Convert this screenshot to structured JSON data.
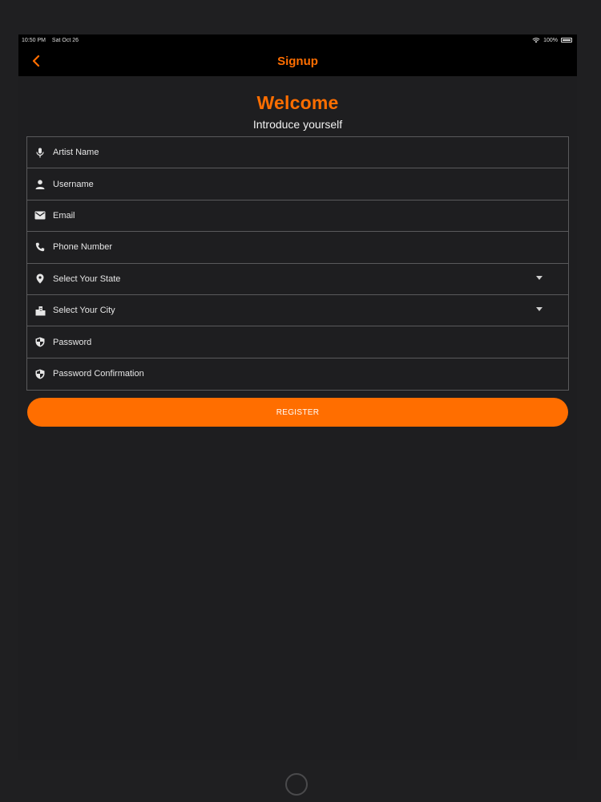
{
  "status_bar": {
    "time": "10:50 PM",
    "date": "Sat Oct 26",
    "battery": "100%"
  },
  "nav": {
    "title": "Signup",
    "back_icon": "chevron-left-icon"
  },
  "header": {
    "welcome": "Welcome",
    "subtitle": "Introduce yourself"
  },
  "form": {
    "fields": [
      {
        "label": "Artist Name",
        "icon": "microphone-icon"
      },
      {
        "label": "Username",
        "icon": "person-icon"
      },
      {
        "label": "Email",
        "icon": "mail-icon"
      },
      {
        "label": "Phone Number",
        "icon": "phone-icon"
      },
      {
        "label": "Select Your State",
        "icon": "location-pin-icon"
      },
      {
        "label": "Select Your City",
        "icon": "city-icon"
      },
      {
        "label": "Password",
        "icon": "shield-icon"
      },
      {
        "label": "Password Confirmation",
        "icon": "shield-icon"
      }
    ]
  },
  "register_label": "REGISTER",
  "colors": {
    "accent": "#ff6e00",
    "background": "#1e1e20",
    "nav_background": "#000000"
  }
}
